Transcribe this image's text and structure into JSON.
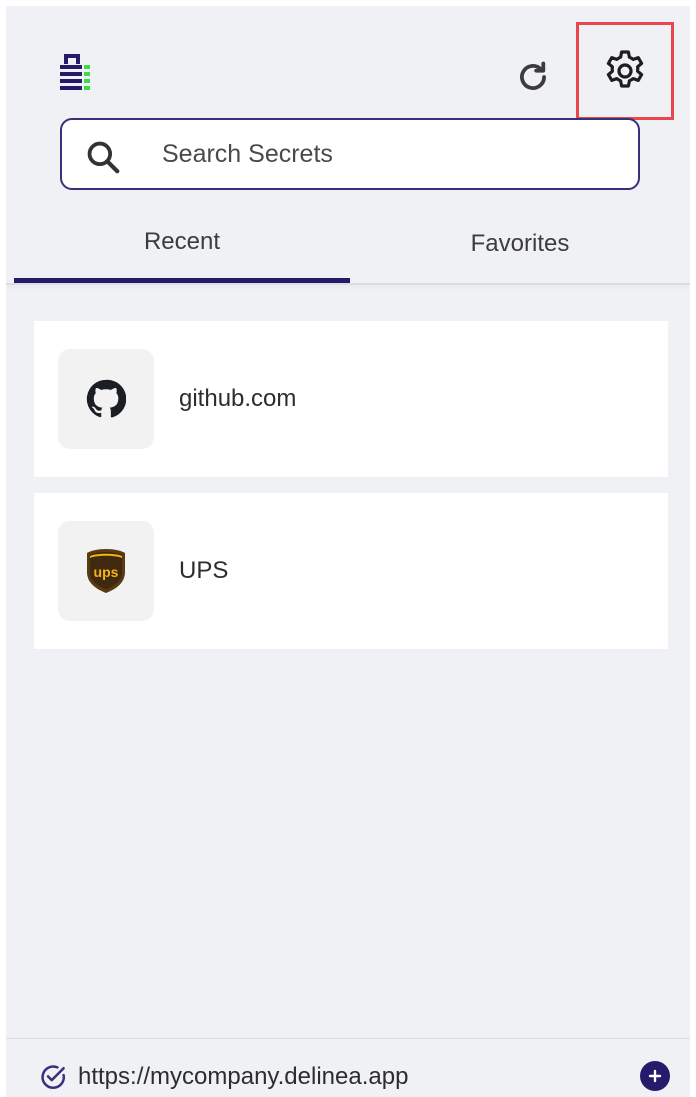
{
  "header": {
    "logo_icon": "delinea-logo-icon",
    "refresh_icon": "refresh-icon",
    "settings_icon": "gear-icon",
    "highlight_color": "#e8484d"
  },
  "search": {
    "placeholder": "Search Secrets",
    "value": ""
  },
  "tabs": [
    {
      "label": "Recent",
      "active": true
    },
    {
      "label": "Favorites",
      "active": false
    }
  ],
  "secrets": [
    {
      "label": "github.com",
      "icon": "github-icon"
    },
    {
      "label": "UPS",
      "icon": "ups-logo-icon"
    }
  ],
  "footer": {
    "url": "https://mycompany.delinea.app",
    "status_icon": "check-circle-icon",
    "add_icon": "plus-circle-icon"
  },
  "colors": {
    "brand": "#241c6b",
    "accent_green": "#3fd94a",
    "background": "#f0f1f5"
  }
}
